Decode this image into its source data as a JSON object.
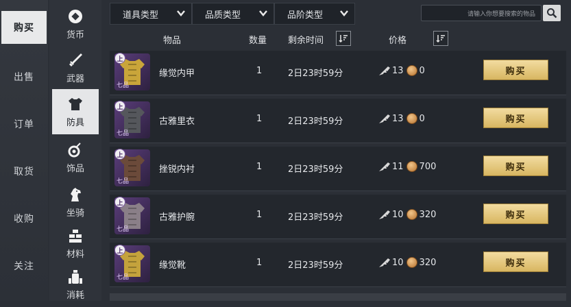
{
  "main_nav": {
    "items": [
      {
        "label": "购买",
        "active": true
      },
      {
        "label": "出售"
      },
      {
        "label": "订单"
      },
      {
        "label": "取货"
      },
      {
        "label": "收购"
      },
      {
        "label": "关注"
      }
    ]
  },
  "categories": [
    {
      "label": "货币",
      "icon": "currency-icon"
    },
    {
      "label": "武器",
      "icon": "sword-icon"
    },
    {
      "label": "防具",
      "icon": "armor-icon",
      "active": true
    },
    {
      "label": "饰品",
      "icon": "accessory-icon"
    },
    {
      "label": "坐骑",
      "icon": "horse-icon"
    },
    {
      "label": "材料",
      "icon": "materials-icon"
    },
    {
      "label": "消耗",
      "icon": "consumable-icon"
    }
  ],
  "filters": {
    "item_type": "道具类型",
    "quality_type": "品质类型",
    "tier_type": "品阶类型",
    "search_placeholder": "请输入你想要搜索的物品"
  },
  "table": {
    "headers": {
      "item": "物品",
      "quantity": "数量",
      "time_left": "剩余时间",
      "price": "价格"
    },
    "buy_label": "购买",
    "rows": [
      {
        "name": "缘觉内甲",
        "quantity": "1",
        "time_left": "2日23时59分",
        "price_a": "13",
        "price_b": "0",
        "tier": "上",
        "grade": "七品",
        "color": "#c9a53a"
      },
      {
        "name": "古雅里衣",
        "quantity": "1",
        "time_left": "2日23时59分",
        "price_a": "13",
        "price_b": "0",
        "tier": "上",
        "grade": "七品",
        "color": "#55575c"
      },
      {
        "name": "挫锐内衬",
        "quantity": "1",
        "time_left": "2日23时59分",
        "price_a": "11",
        "price_b": "700",
        "tier": "上",
        "grade": "七品",
        "color": "#6b4a3a"
      },
      {
        "name": "古雅护腕",
        "quantity": "1",
        "time_left": "2日23时59分",
        "price_a": "10",
        "price_b": "320",
        "tier": "上",
        "grade": "七品",
        "color": "#8a7f88"
      },
      {
        "name": "缘觉靴",
        "quantity": "1",
        "time_left": "2日23时59分",
        "price_a": "10",
        "price_b": "320",
        "tier": "上",
        "grade": "七品",
        "color": "#c4a23c"
      }
    ]
  },
  "colors": {
    "accent_gold": "#d8b661",
    "row_bg": "#23272d",
    "item_frame": "#5a3d7a"
  }
}
